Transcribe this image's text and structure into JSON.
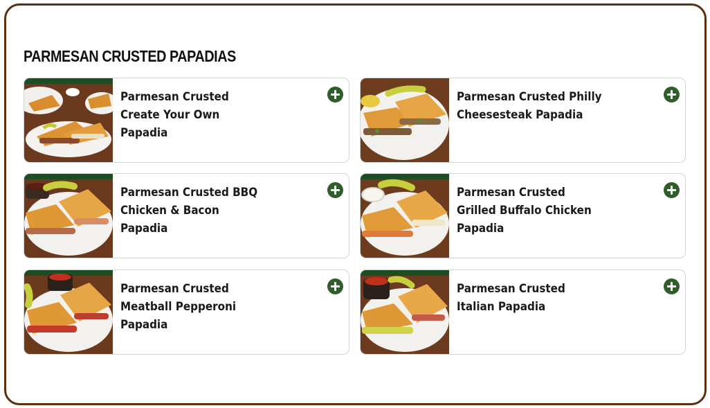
{
  "section": {
    "title": "PARMESAN CRUSTED PAPADIAS"
  },
  "colors": {
    "frame_border": "#5a2f12",
    "add_button": "#2f5e2a",
    "card_border": "#d4d4d4"
  },
  "items": [
    {
      "name": "Parmesan Crusted Create Your Own Papadia",
      "lines": [
        "Parmesan Crusted",
        "Create Your Own",
        "Papadia"
      ],
      "icon": "plus-circle-icon"
    },
    {
      "name": "Parmesan Crusted Philly Cheesesteak Papadia",
      "lines": [
        "Parmesan Crusted Philly",
        "Cheesesteak Papadia"
      ],
      "icon": "plus-circle-icon"
    },
    {
      "name": "Parmesan Crusted BBQ Chicken & Bacon Papadia",
      "lines": [
        "Parmesan Crusted BBQ",
        "Chicken & Bacon",
        "Papadia"
      ],
      "icon": "plus-circle-icon"
    },
    {
      "name": "Parmesan Crusted Grilled Buffalo Chicken Papadia",
      "lines": [
        "Parmesan Crusted",
        "Grilled Buffalo Chicken",
        "Papadia"
      ],
      "icon": "plus-circle-icon"
    },
    {
      "name": "Parmesan Crusted Meatball Pepperoni Papadia",
      "lines": [
        "Parmesan Crusted",
        "Meatball Pepperoni",
        "Papadia"
      ],
      "icon": "plus-circle-icon"
    },
    {
      "name": "Parmesan Crusted Italian Papadia",
      "lines": [
        "Parmesan Crusted",
        "Italian Papadia"
      ],
      "icon": "plus-circle-icon"
    }
  ]
}
